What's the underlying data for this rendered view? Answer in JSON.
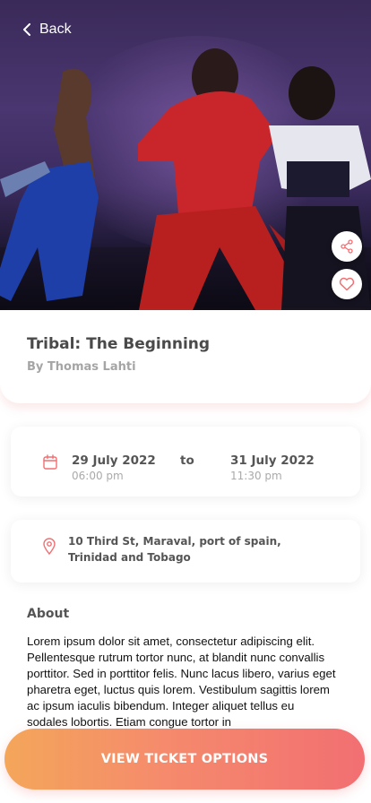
{
  "header": {
    "back_label": "Back"
  },
  "event": {
    "title": "Tribal: The Beginning",
    "author": "By Thomas Lahti"
  },
  "dates": {
    "start_date": "29 July 2022",
    "start_time": "06:00 pm",
    "separator": "to",
    "end_date": "31 July 2022",
    "end_time": "11:30 pm"
  },
  "location": {
    "address": "10 Third St, Maraval, port of spain, Trinidad and Tobago"
  },
  "about": {
    "heading": "About",
    "text": "Lorem ipsum dolor sit amet, consectetur adipiscing elit. Pellentesque rutrum tortor nunc, at blandit nunc convallis porttitor. Sed in porttitor felis. Nunc lacus libero, varius eget pharetra eget, luctus quis lorem. Vestibulum sagittis lorem ac ipsum iaculis bibendum. Integer aliquet tellus eu sodales lobortis. Etiam congue tortor in"
  },
  "cta": {
    "label": "VIEW TICKET OPTIONS"
  },
  "icons": {
    "back": "chevron-left-icon",
    "share": "share-icon",
    "favorite": "heart-icon",
    "calendar": "calendar-icon",
    "location": "map-pin-icon"
  },
  "colors": {
    "accent": "#f26f72",
    "cta_start": "#f4a65a",
    "cta_end": "#f26f72"
  }
}
